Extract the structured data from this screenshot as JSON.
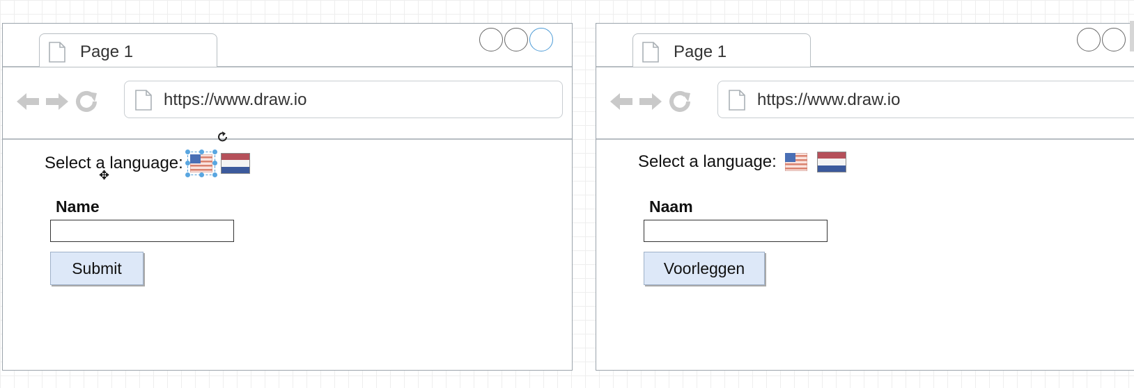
{
  "colors": {
    "frame_border": "#9aa3ab",
    "selection": "#4d9bd6",
    "button_bg": "#dde8f8"
  },
  "windows": [
    {
      "tab": {
        "label": "Page 1",
        "icon": "page-icon"
      },
      "address": {
        "url": "https://www.draw.io",
        "icon": "page-icon"
      },
      "nav_icons": [
        "back-arrow-icon",
        "forward-arrow-icon",
        "reload-icon"
      ],
      "language": {
        "label": "Select a language:",
        "flags": [
          "us-flag-icon",
          "nl-flag-icon"
        ]
      },
      "form": {
        "field_label": "Name",
        "field_value": "",
        "submit_label": "Submit"
      }
    },
    {
      "tab": {
        "label": "Page 1",
        "icon": "page-icon"
      },
      "address": {
        "url": "https://www.draw.io",
        "icon": "page-icon"
      },
      "nav_icons": [
        "back-arrow-icon",
        "forward-arrow-icon",
        "reload-icon"
      ],
      "language": {
        "label": "Select a language:",
        "flags": [
          "us-flag-icon",
          "nl-flag-icon"
        ]
      },
      "form": {
        "field_label": "Naam",
        "field_value": "",
        "submit_label": "Voorleggen"
      }
    }
  ]
}
